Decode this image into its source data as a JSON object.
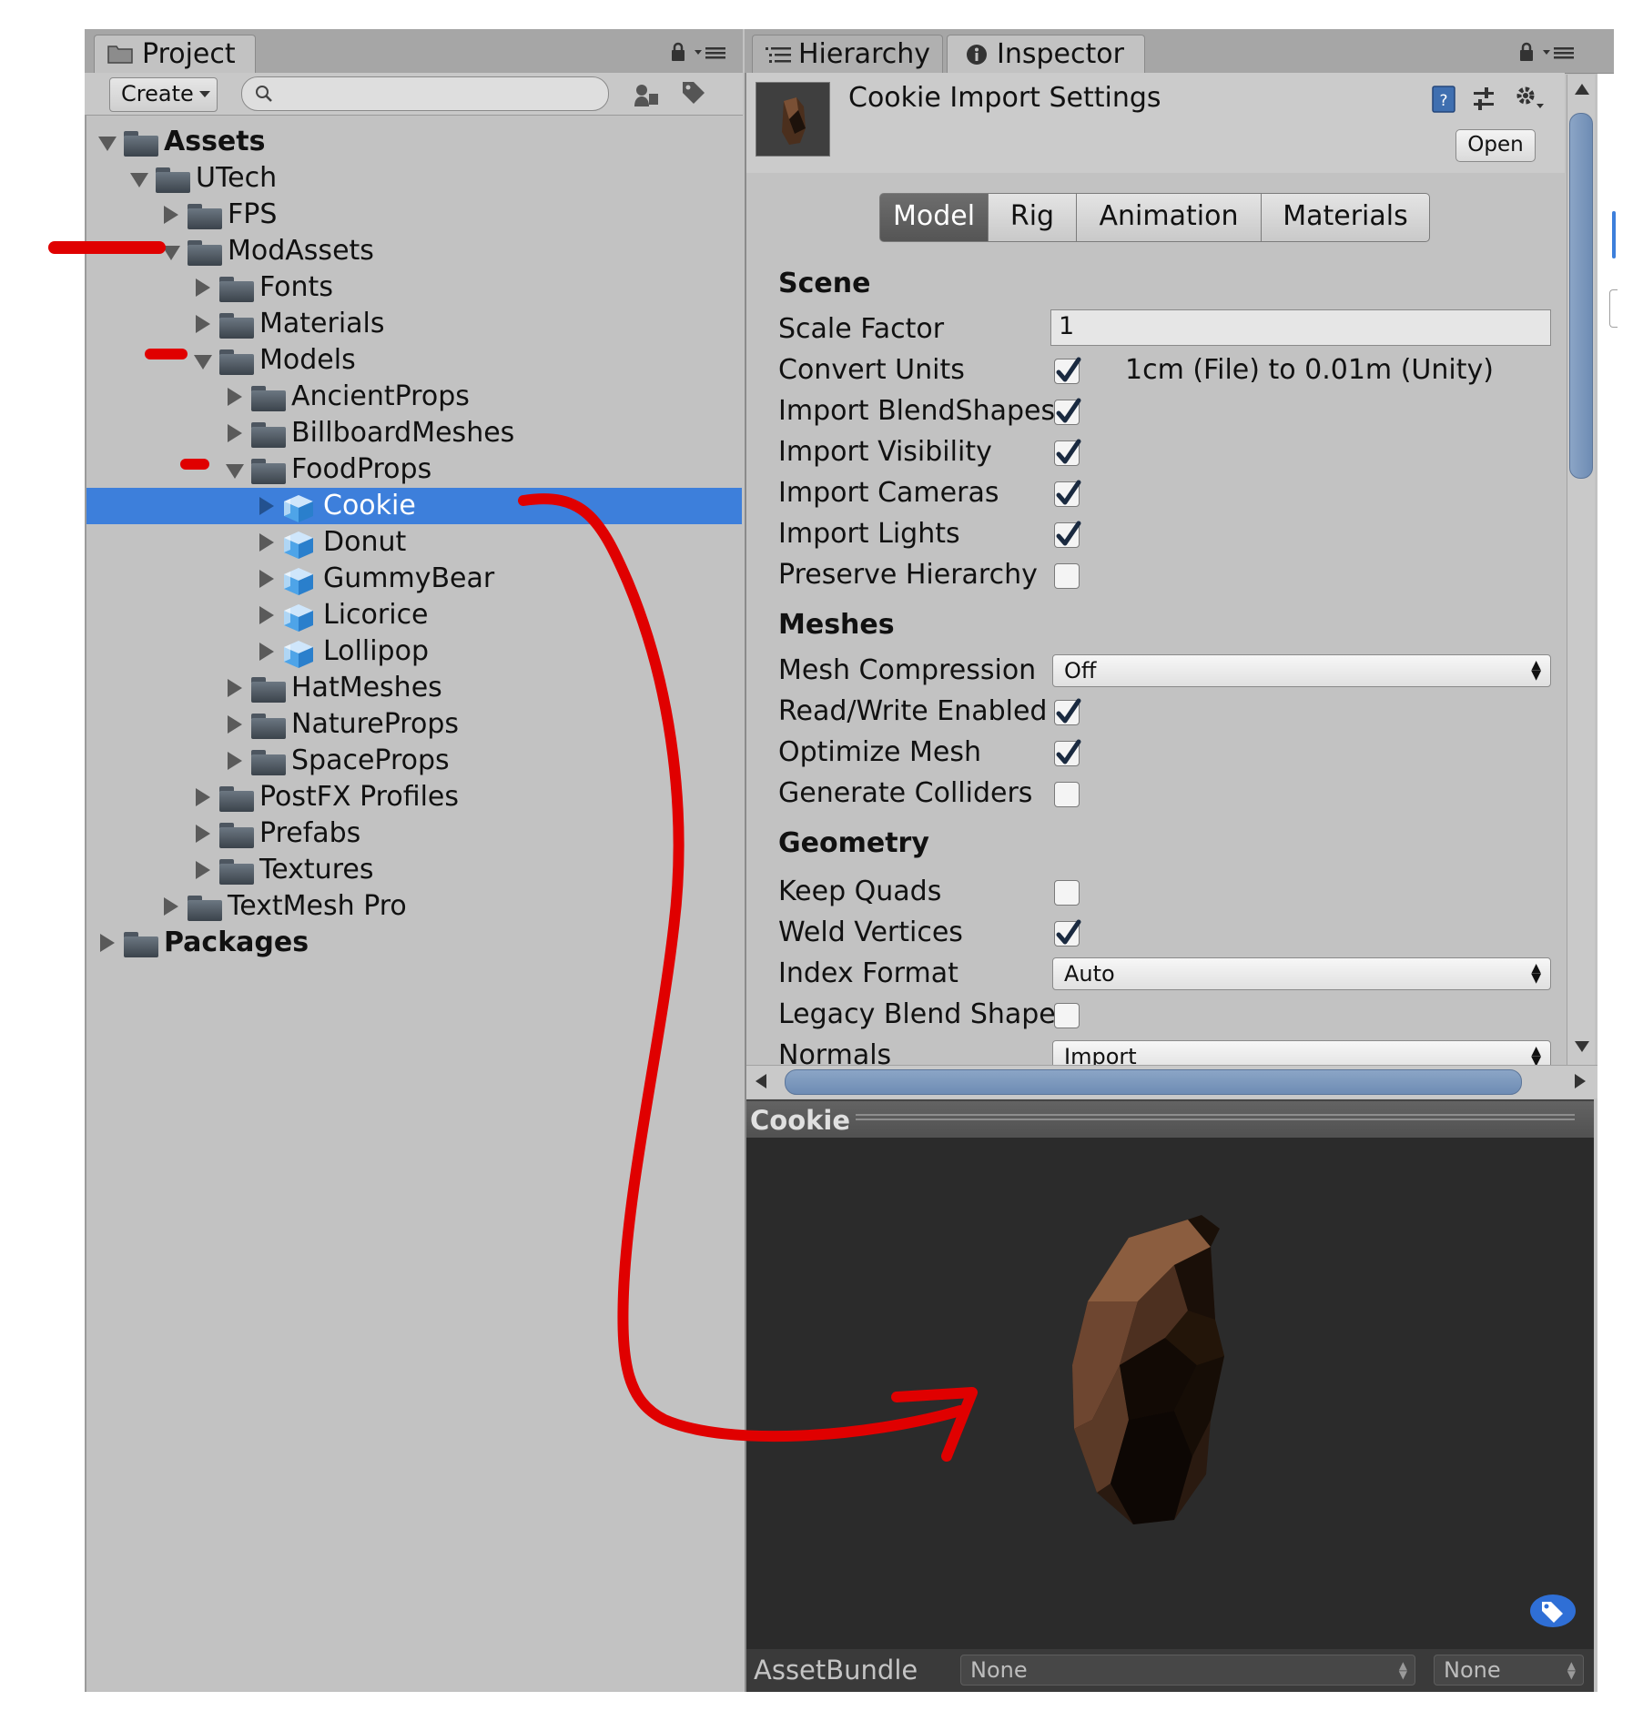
{
  "project": {
    "tab_label": "Project",
    "create_label": "Create",
    "search": {
      "value": "",
      "placeholder": ""
    },
    "tree": [
      {
        "label": "Assets",
        "state": "expanded",
        "bold": true,
        "icon": "folder-icon"
      },
      {
        "label": "UTech",
        "state": "expanded",
        "icon": "folder-icon"
      },
      {
        "label": "FPS",
        "state": "collapsed",
        "icon": "folder-icon"
      },
      {
        "label": "ModAssets",
        "state": "expanded",
        "icon": "folder-icon"
      },
      {
        "label": "Fonts",
        "state": "collapsed",
        "icon": "folder-icon"
      },
      {
        "label": "Materials",
        "state": "collapsed",
        "icon": "folder-icon"
      },
      {
        "label": "Models",
        "state": "expanded",
        "icon": "folder-icon"
      },
      {
        "label": "AncientProps",
        "state": "collapsed",
        "icon": "folder-icon"
      },
      {
        "label": "BillboardMeshes",
        "state": "collapsed",
        "icon": "folder-icon"
      },
      {
        "label": "FoodProps",
        "state": "expanded",
        "icon": "folder-icon"
      },
      {
        "label": "Cookie",
        "state": "collapsed",
        "icon": "model-prefab-icon",
        "selected": true
      },
      {
        "label": "Donut",
        "state": "collapsed",
        "icon": "model-prefab-icon"
      },
      {
        "label": "GummyBear",
        "state": "collapsed",
        "icon": "model-prefab-icon"
      },
      {
        "label": "Licorice",
        "state": "collapsed",
        "icon": "model-prefab-icon"
      },
      {
        "label": "Lollipop",
        "state": "collapsed",
        "icon": "model-prefab-icon"
      },
      {
        "label": "HatMeshes",
        "state": "collapsed",
        "icon": "folder-icon"
      },
      {
        "label": "NatureProps",
        "state": "collapsed",
        "icon": "folder-icon"
      },
      {
        "label": "SpaceProps",
        "state": "collapsed",
        "icon": "folder-icon"
      },
      {
        "label": "PostFX Profiles",
        "state": "collapsed",
        "icon": "folder-icon"
      },
      {
        "label": "Prefabs",
        "state": "collapsed",
        "icon": "folder-icon"
      },
      {
        "label": "Textures",
        "state": "collapsed",
        "icon": "folder-icon"
      },
      {
        "label": "TextMesh Pro",
        "state": "collapsed",
        "icon": "folder-icon"
      },
      {
        "label": "Packages",
        "state": "collapsed",
        "bold": true,
        "icon": "folder-icon"
      }
    ]
  },
  "hierarchy": {
    "tab_label": "Hierarchy"
  },
  "inspector": {
    "tab_label": "Inspector",
    "title": "Cookie Import Settings",
    "open_button": "Open",
    "tabs": [
      "Model",
      "Rig",
      "Animation",
      "Materials"
    ],
    "active_tab": "Model",
    "scene": {
      "heading": "Scene",
      "scale_factor": {
        "label": "Scale Factor",
        "value": "1"
      },
      "convert_units": {
        "label": "Convert Units",
        "checked": true,
        "note": "1cm (File) to 0.01m (Unity)"
      },
      "import_blendshapes": {
        "label": "Import BlendShapes",
        "checked": true
      },
      "import_visibility": {
        "label": "Import Visibility",
        "checked": true
      },
      "import_cameras": {
        "label": "Import Cameras",
        "checked": true
      },
      "import_lights": {
        "label": "Import Lights",
        "checked": true
      },
      "preserve_hierarchy": {
        "label": "Preserve Hierarchy",
        "checked": false
      }
    },
    "meshes": {
      "heading": "Meshes",
      "mesh_compression": {
        "label": "Mesh Compression",
        "value": "Off"
      },
      "read_write": {
        "label": "Read/Write Enabled",
        "checked": true
      },
      "optimize_mesh": {
        "label": "Optimize Mesh",
        "checked": true
      },
      "generate_colliders": {
        "label": "Generate Colliders",
        "checked": false
      }
    },
    "geometry": {
      "heading": "Geometry",
      "keep_quads": {
        "label": "Keep Quads",
        "checked": false
      },
      "weld_vertices": {
        "label": "Weld Vertices",
        "checked": true
      },
      "index_format": {
        "label": "Index Format",
        "value": "Auto"
      },
      "legacy_blend_shape": {
        "label": "Legacy Blend Shape",
        "checked": false
      },
      "normals": {
        "label": "Normals",
        "value": "Import"
      }
    },
    "preview": {
      "title": "Cookie",
      "assetbundle_label": "AssetBundle",
      "assetbundle_value": "None",
      "variant_value": "None"
    }
  },
  "colors": {
    "selection": "#3d7fdb",
    "annotation": "#e00000",
    "panel_bg": "#c2c2c2",
    "preview_bg": "#2b2b2b"
  }
}
